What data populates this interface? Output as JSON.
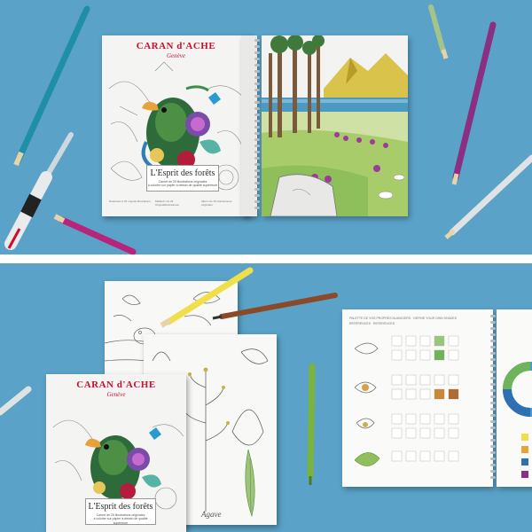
{
  "cover_top": {
    "brand": "CARAN d'ACHE",
    "brand_sub": "Genève",
    "title": "L'Esprit des forêts",
    "subtitle_line1": "Carnet de 25 illustrations originales",
    "subtitle_line2": "à colorier sur papier à dessin de qualité supérieure",
    "footer_col1": "Notebook of 25 original illustrations",
    "footer_col2": "Malbuch mit 25 Originalillustrationen",
    "footer_col3": "Album de 25 ilustraciones originales"
  },
  "cover_bottom": {
    "brand": "CARAN d'ACHE",
    "brand_sub": "Genève",
    "title": "L'Esprit des forêts",
    "subtitle_line1": "Carnet de 25 illustrations originales",
    "subtitle_line2": "à colorier sur papier à dessin de qualité supérieure"
  },
  "swatch_page": {
    "header_line1": "PALETTE DE VOS PROPRES NUANCIERS · DEFINE YOUR OWN SHADES",
    "header_line2": "RÉFÉRENCES · REFERENCES"
  },
  "plant_page": {
    "signature": "Agave"
  },
  "colors": {
    "background": "#5aa2c8",
    "brand_red": "#c8102e"
  }
}
